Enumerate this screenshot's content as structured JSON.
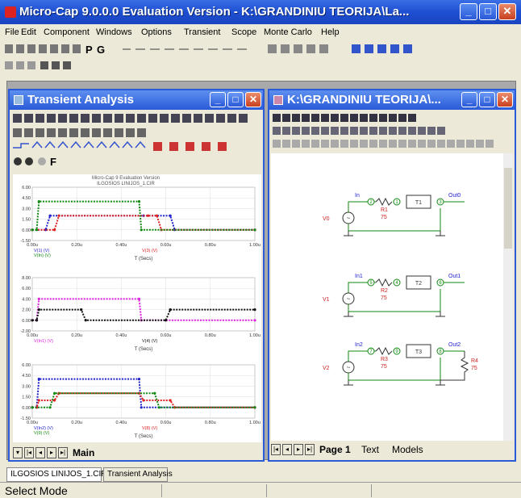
{
  "app": {
    "title": "Micro-Cap 9.0.0.0 Evaluation Version - K:\\GRANDINIU TEORIJA\\La..."
  },
  "menu": [
    "File",
    "Edit",
    "Component",
    "Windows",
    "Options",
    "Transient",
    "Scope",
    "Monte Carlo",
    "Help"
  ],
  "transient_window": {
    "title": "Transient Analysis",
    "plot_header": [
      "Micro-Cap 9 Evaluation Version",
      "ILGOSIOS LINIJOS_1.CIR"
    ],
    "tab": "Main"
  },
  "schematic_window": {
    "title": "K:\\GRANDINIU TEORIJA\\...",
    "tabs": [
      "Page 1",
      "Text",
      "Models"
    ],
    "circuits": [
      {
        "source": "V0",
        "r_label": "R1",
        "r_value": "75",
        "line": "T1",
        "in_node": "In",
        "out_node": "Out0",
        "n1": "2",
        "n2": "1",
        "n3": "3"
      },
      {
        "source": "V1",
        "r_label": "R2",
        "r_value": "75",
        "line": "T2",
        "in_node": "In1",
        "out_node": "Out1",
        "n1": "5",
        "n2": "4",
        "n3": "6"
      },
      {
        "source": "V2",
        "r_label": "R3",
        "r_value": "75",
        "line": "T3",
        "in_node": "In2",
        "out_node": "Out2",
        "n1": "7",
        "n2": "9",
        "n3": "8",
        "load_label": "R4",
        "load_value": "75"
      }
    ]
  },
  "bottom_tabs": [
    "ILGOSIOS LINIJOS_1.CIR",
    "Transient Analysis"
  ],
  "status": {
    "text": "Select Mode"
  },
  "chart_data": [
    {
      "type": "line",
      "x_ticks": [
        "0.00u",
        "0.20u",
        "0.40u",
        "0.60u",
        "0.80u",
        "1.00u"
      ],
      "y_ticks": [
        "6.00",
        "4.50",
        "3.00",
        "1.50",
        "0.00",
        "-1.50"
      ],
      "xlabel": "T (Secs)",
      "ylim": [
        -1.5,
        6.0
      ],
      "xlim": [
        0.0,
        1.0
      ],
      "legend": [
        "V(1) (V)",
        "V(3) (V)",
        "V(In) (V)"
      ],
      "series": [
        {
          "name": "V(1) (V)",
          "color": "#2222cc",
          "x": [
            0,
            0.06,
            0.08,
            0.5,
            0.62,
            0.64,
            1.0
          ],
          "y": [
            0,
            0,
            2.0,
            2.0,
            2.0,
            0,
            0
          ]
        },
        {
          "name": "V(3) (V)",
          "color": "#dd2222",
          "x": [
            0,
            0.1,
            0.12,
            0.52,
            0.56,
            0.58,
            1.0
          ],
          "y": [
            0,
            0,
            2.0,
            2.0,
            2.0,
            0,
            0
          ]
        },
        {
          "name": "V(In) (V)",
          "color": "#118811",
          "x": [
            0,
            0.02,
            0.03,
            0.48,
            0.49,
            1.0
          ],
          "y": [
            0,
            0,
            4.0,
            4.0,
            0,
            0
          ]
        }
      ]
    },
    {
      "type": "line",
      "x_ticks": [
        "0.00u",
        "0.20u",
        "0.40u",
        "0.60u",
        "0.80u",
        "1.00u"
      ],
      "y_ticks": [
        "8.00",
        "6.00",
        "4.00",
        "2.00",
        "0.00",
        "-2.00"
      ],
      "xlabel": "T (Secs)",
      "ylim": [
        -2.0,
        8.0
      ],
      "xlim": [
        0.0,
        1.0
      ],
      "legend": [
        "V(In1) (V)",
        "V(4) (V)"
      ],
      "series": [
        {
          "name": "V(In1) (V)",
          "color": "#dd22dd",
          "x": [
            0,
            0.02,
            0.03,
            0.48,
            0.49,
            1.0
          ],
          "y": [
            0,
            0,
            4.0,
            4.0,
            0,
            0
          ]
        },
        {
          "name": "V(4) (V)",
          "color": "#111111",
          "x": [
            0,
            0.02,
            0.03,
            0.22,
            0.24,
            0.6,
            0.62,
            1.0
          ],
          "y": [
            0,
            0,
            2.0,
            2.0,
            0,
            0,
            2.0,
            2.0
          ]
        }
      ]
    },
    {
      "type": "line",
      "x_ticks": [
        "0.00u",
        "0.20u",
        "0.40u",
        "0.60u",
        "0.80u",
        "1.00u"
      ],
      "y_ticks": [
        "6.00",
        "4.50",
        "3.00",
        "1.50",
        "0.00",
        "-1.50"
      ],
      "xlabel": "T (Secs)",
      "ylim": [
        -1.5,
        6.0
      ],
      "xlim": [
        0.0,
        1.0
      ],
      "legend": [
        "V(In2) (V)",
        "V(8) (V)",
        "V(9) (V)"
      ],
      "series": [
        {
          "name": "V(In2) (V)",
          "color": "#2222cc",
          "x": [
            0,
            0.02,
            0.03,
            0.48,
            0.49,
            1.0
          ],
          "y": [
            0,
            0,
            4.0,
            4.0,
            0,
            0
          ]
        },
        {
          "name": "V(8) (V)",
          "color": "#dd2222",
          "x": [
            0,
            0.02,
            0.03,
            0.1,
            0.12,
            0.48,
            0.5,
            0.62,
            0.64,
            1.0
          ],
          "y": [
            0,
            0,
            1.0,
            1.0,
            2.0,
            2.0,
            1.0,
            1.0,
            0,
            0
          ]
        },
        {
          "name": "V(9) (V)",
          "color": "#118811",
          "x": [
            0,
            0.08,
            0.1,
            0.55,
            0.57,
            1.0
          ],
          "y": [
            0,
            0,
            2.0,
            2.0,
            0,
            0
          ]
        }
      ]
    }
  ]
}
